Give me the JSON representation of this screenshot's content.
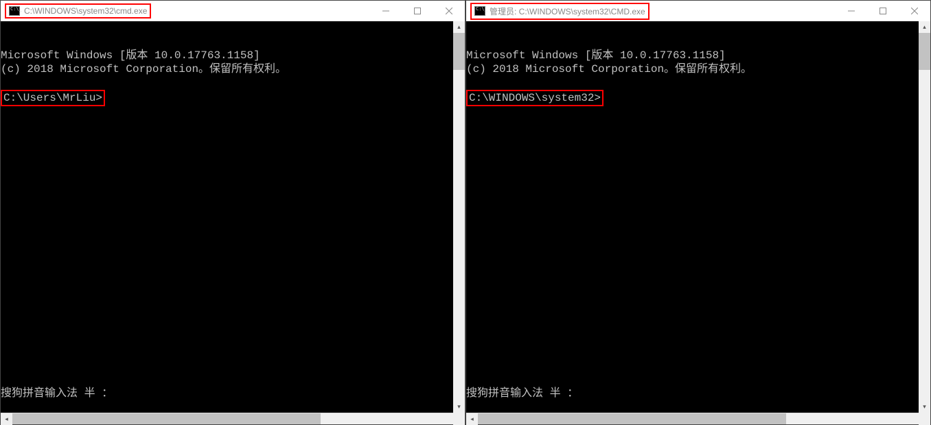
{
  "left": {
    "title": "C:\\WINDOWS\\system32\\cmd.exe",
    "line1": "Microsoft Windows [版本 10.0.17763.1158]",
    "line2": "(c) 2018 Microsoft Corporation。保留所有权利。",
    "prompt": "C:\\Users\\MrLiu>",
    "ime": "搜狗拼音输入法 半 ："
  },
  "right": {
    "title": "管理员: C:\\WINDOWS\\system32\\CMD.exe",
    "line1": "Microsoft Windows [版本 10.0.17763.1158]",
    "line2": "(c) 2018 Microsoft Corporation。保留所有权利。",
    "prompt": "C:\\WINDOWS\\system32>",
    "ime": "搜狗拼音输入法 半 ："
  }
}
